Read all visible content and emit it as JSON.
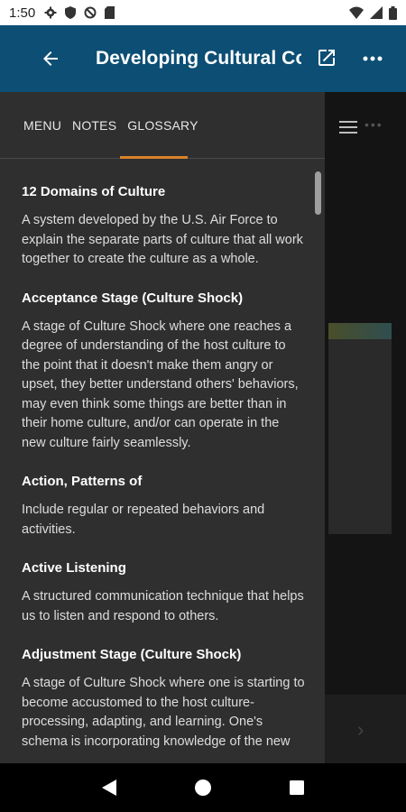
{
  "status_bar": {
    "time": "1:50",
    "icons": [
      "gear-icon",
      "shield-icon",
      "blocked-circle-icon",
      "sd-card-icon"
    ],
    "right_icons": [
      "wifi-icon",
      "signal-icon",
      "battery-icon"
    ]
  },
  "app_bar": {
    "title": "Developing Cultural Co...",
    "back_icon": "arrow-left-icon",
    "open_icon": "open-in-new-icon",
    "more_icon": "more-horizontal-icon"
  },
  "drawer": {
    "tabs": [
      {
        "label": "MENU"
      },
      {
        "label": "NOTES"
      },
      {
        "label": "GLOSSARY"
      }
    ],
    "active_tab": "GLOSSARY",
    "glossary": [
      {
        "term": "12 Domains of Culture",
        "definition": "A system developed by the U.S. Air Force to explain the separate parts of culture that all work together to create the culture as a whole."
      },
      {
        "term": "Acceptance Stage (Culture Shock)",
        "definition": "A stage of Culture Shock where one reaches a degree of understanding of the host culture to the point that it doesn't make them angry or upset, they better understand others' behaviors, may even think some things are better than in their home culture, and/or can operate in the new culture fairly seamlessly."
      },
      {
        "term": "Action, Patterns of",
        "definition": "Include regular or repeated behaviors and activities."
      },
      {
        "term": "Active Listening",
        "definition": "A structured communication technique that helps us to listen and respond to others."
      },
      {
        "term": "Adjustment Stage (Culture Shock)",
        "definition": "A stage of Culture Shock where one is starting to become accustomed to the host culture-processing, adapting, and learning. One's schema is incorporating knowledge of the new"
      }
    ]
  },
  "colors": {
    "app_bar": "#0c4e74",
    "drawer_bg": "#2f2f2f",
    "accent": "#d9822b"
  },
  "nav_bar": {
    "icons": [
      "back-triangle-icon",
      "home-circle-icon",
      "recents-square-icon"
    ]
  }
}
